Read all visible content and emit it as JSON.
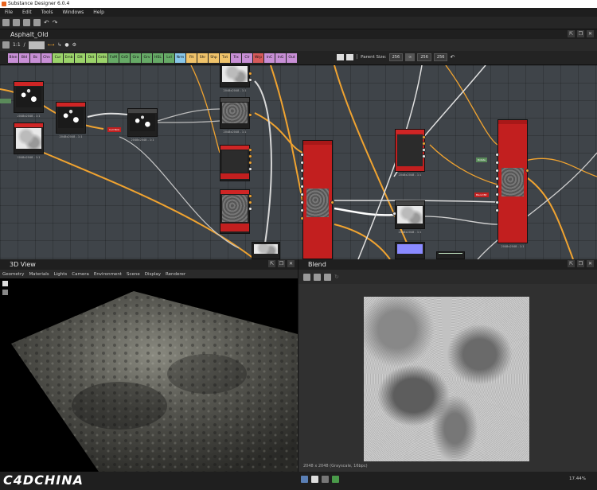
{
  "app": {
    "title": "Substance Designer 6.0.4"
  },
  "menu": [
    "File",
    "Edit",
    "Tools",
    "Windows",
    "Help"
  ],
  "graph": {
    "tab_title": "Asphalt_Old",
    "zoom_label": "1:1",
    "parent_size_label": "Parent Size:",
    "parent_size_value": "256",
    "output_w": "256",
    "output_h": "256",
    "filters": [
      {
        "label": "Blen",
        "color": "#c88fd6"
      },
      {
        "label": "Bld",
        "color": "#c88fd6"
      },
      {
        "label": "Bc",
        "color": "#c88fd6"
      },
      {
        "label": "Chn",
        "color": "#c88fd6"
      },
      {
        "label": "Cur",
        "color": "#9bd36a"
      },
      {
        "label": "Emb",
        "color": "#9bd36a"
      },
      {
        "label": "Dlt",
        "color": "#9bd36a"
      },
      {
        "label": "Dst",
        "color": "#9bd36a"
      },
      {
        "label": "Grds",
        "color": "#9bd36a"
      },
      {
        "label": "FxM",
        "color": "#66aa66"
      },
      {
        "label": "GrD",
        "color": "#66aa66"
      },
      {
        "label": "Gra",
        "color": "#66aa66"
      },
      {
        "label": "Grv",
        "color": "#66aa66"
      },
      {
        "label": "HSL",
        "color": "#66aa66"
      },
      {
        "label": "Lvl",
        "color": "#66aa66"
      },
      {
        "label": "Nrm",
        "color": "#88c6e8"
      },
      {
        "label": "Flt",
        "color": "#f0c36a"
      },
      {
        "label": "Shr",
        "color": "#f0c36a"
      },
      {
        "label": "Shp",
        "color": "#f0c36a"
      },
      {
        "label": "Txt",
        "color": "#f0c36a"
      },
      {
        "label": "Trx",
        "color": "#c88fd6"
      },
      {
        "label": "Clr",
        "color": "#c88fd6"
      },
      {
        "label": "Wrp",
        "color": "#d65a5a"
      },
      {
        "label": "InC",
        "color": "#c88fd6"
      },
      {
        "label": "InG",
        "color": "#c88fd6"
      },
      {
        "label": "Out",
        "color": "#c88fd6"
      }
    ],
    "captions": {
      "n1": "2048x2048 - 1:1",
      "n2": "2048x2048 - 1:1",
      "n3": "2048x2048 - 1:1",
      "n4": "2048x2048 - 1:1",
      "n5": "2048x2048 - 1:1",
      "n6": "2048x2048 - 1:1",
      "n7": "2048x2048 - 1:1",
      "n8": "2048x2048 - 1:1",
      "n9": "2048x2048 - 1:1",
      "n10": "2048x2048 - 1:1"
    },
    "small_nodes": {
      "a": "Cull Blob",
      "b": "Rotate",
      "c": "Rend",
      "d": "Blend Blt"
    }
  },
  "view3d": {
    "tab_title": "3D View",
    "menu": [
      "Geometry",
      "Materials",
      "Lights",
      "Camera",
      "Environment",
      "Scene",
      "Display",
      "Renderer"
    ]
  },
  "blend": {
    "tab_title": "Blend",
    "info": "2048 x 2048 (Grayscale, 16bpc)",
    "zoom": "17.44%"
  },
  "watermark": "C4DCHINA",
  "icons": [
    "app-icon",
    "close-icon",
    "float-icon",
    "pin-icon",
    "gear-icon",
    "undo-icon",
    "redo-icon",
    "camera-icon",
    "save-icon"
  ]
}
